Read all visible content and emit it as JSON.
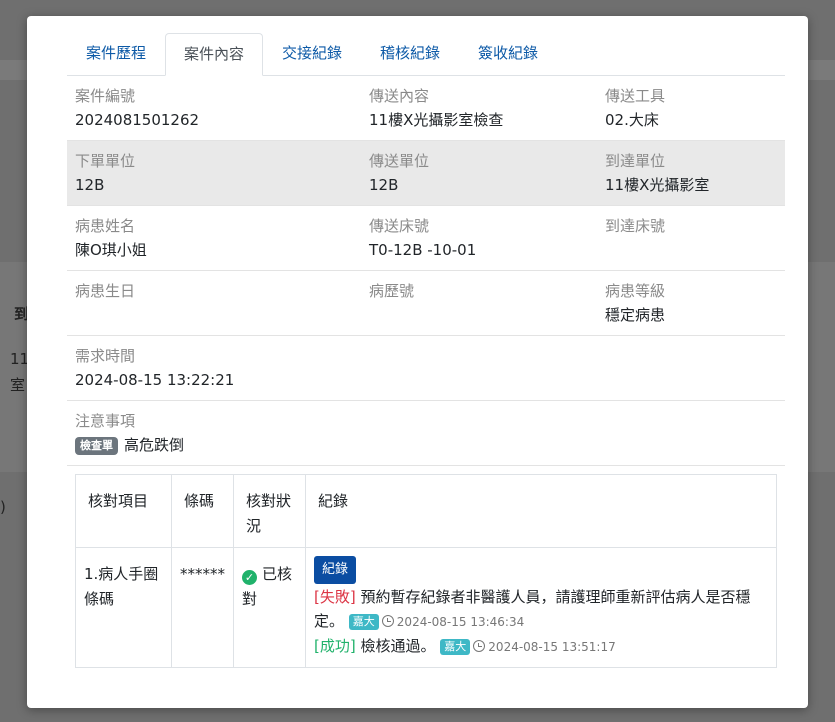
{
  "background": {
    "col_header": "到",
    "row_text_1": "11",
    "row_text_2": "室",
    "side_text": ")"
  },
  "tabs": [
    {
      "label": "案件歷程",
      "active": false
    },
    {
      "label": "案件內容",
      "active": true
    },
    {
      "label": "交接紀錄",
      "active": false
    },
    {
      "label": "稽核紀錄",
      "active": false
    },
    {
      "label": "簽收紀錄",
      "active": false
    }
  ],
  "case": {
    "case_no_label": "案件編號",
    "case_no": "2024081501262",
    "content_label": "傳送內容",
    "content": "11樓X光攝影室檢查",
    "tool_label": "傳送工具",
    "tool": "02.大床",
    "order_unit_label": "下單單位",
    "order_unit": "12B",
    "send_unit_label": "傳送單位",
    "send_unit": "12B",
    "arrive_unit_label": "到達單位",
    "arrive_unit": "11樓X光攝影室",
    "patient_name_label": "病患姓名",
    "patient_name": "陳O琪小姐",
    "send_bed_label": "傳送床號",
    "send_bed": "T0-12B -10-01",
    "arrive_bed_label": "到達床號",
    "arrive_bed": "",
    "birthday_label": "病患生日",
    "birthday": "",
    "chart_no_label": "病歷號",
    "chart_no": "",
    "level_label": "病患等級",
    "level": "穩定病患",
    "request_time_label": "需求時間",
    "request_time": "2024-08-15 13:22:21",
    "notes_label": "注意事項",
    "notes_badge": "檢查單",
    "notes": "高危跌倒"
  },
  "check_table": {
    "headers": [
      "核對項目",
      "條碼",
      "核對狀況",
      "紀錄"
    ],
    "row": {
      "item": "1.病人手圈條碼",
      "barcode": "******",
      "status": "已核對",
      "record_button": "紀錄",
      "records": [
        {
          "tag": "[失敗]",
          "text": "預約暫存紀錄者非醫護人員，請護理師重新評估病人是否穩定。",
          "badge": "嘉大",
          "time": "2024-08-15 13:46:34"
        },
        {
          "tag": "[成功]",
          "text": "檢核通過。",
          "badge": "嘉大",
          "time": "2024-08-15 13:51:17"
        }
      ]
    }
  },
  "colors": {
    "tab_link": "#0d5aa7",
    "fail": "#dc3545",
    "success": "#20b26b",
    "badge_teal": "#3eb8c6",
    "record_button": "#0b4da2"
  }
}
